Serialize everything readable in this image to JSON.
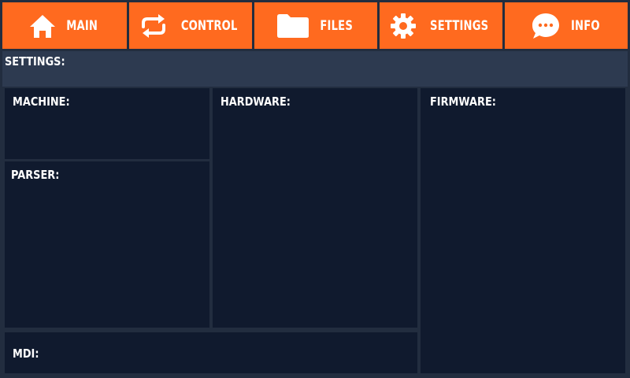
{
  "colors": {
    "tab_bg": "#ff6a1f",
    "app_bg": "#222d3f",
    "header_bg": "#2d3a50",
    "panel_bg": "#101a2e",
    "text": "#ffffff"
  },
  "tabs": [
    {
      "label": "MAIN",
      "icon": "home-icon"
    },
    {
      "label": "CONTROL",
      "icon": "refresh-icon"
    },
    {
      "label": "FILES",
      "icon": "folder-icon"
    },
    {
      "label": "SETTINGS",
      "icon": "gear-icon"
    },
    {
      "label": "INFO",
      "icon": "chat-bubble-icon"
    }
  ],
  "header": {
    "title": "SETTINGS:"
  },
  "panels": {
    "machine": "MACHINE:",
    "parser": "PARSER:",
    "hardware": "HARDWARE:",
    "firmware": "FIRMWARE:",
    "mdi": "MDI:"
  }
}
